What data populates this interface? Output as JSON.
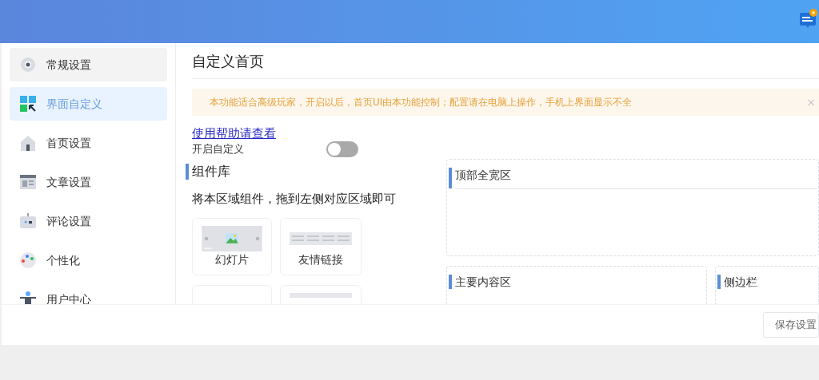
{
  "sidebar": {
    "items": [
      {
        "label": "常规设置",
        "kind": "gear",
        "selected": false,
        "hovered": true
      },
      {
        "label": "界面自定义",
        "kind": "layout",
        "selected": true,
        "hovered": false
      },
      {
        "label": "首页设置",
        "kind": "home",
        "selected": false,
        "hovered": false
      },
      {
        "label": "文章设置",
        "kind": "article",
        "selected": false,
        "hovered": false
      },
      {
        "label": "评论设置",
        "kind": "robot",
        "selected": false,
        "hovered": false
      },
      {
        "label": "个性化",
        "kind": "palette",
        "selected": false,
        "hovered": false
      },
      {
        "label": "用户中心",
        "kind": "user",
        "selected": false,
        "hovered": false
      }
    ]
  },
  "page": {
    "title": "自定义首页",
    "alert": {
      "text": "本功能适合高级玩家，开启以后，首页UI由本功能控制；配置请在电脑上操作，手机上界面显示不全",
      "close": "×"
    },
    "help_link": "使用帮助请查看",
    "toggle": {
      "label": "开启自定义",
      "on": false
    },
    "library": {
      "title": "组件库",
      "hint": "将本区域组件，拖到左侧对应区域即可",
      "components": [
        {
          "label": "幻灯片",
          "kind": "slideshow"
        },
        {
          "label": "友情链接",
          "kind": "links"
        },
        {
          "kind": "blank"
        },
        {
          "kind": "bar"
        }
      ]
    },
    "zones": {
      "top": "顶部全宽区",
      "main": "主要内容区",
      "side": "侧边栏"
    }
  },
  "footer": {
    "save_button": "保存设置"
  }
}
